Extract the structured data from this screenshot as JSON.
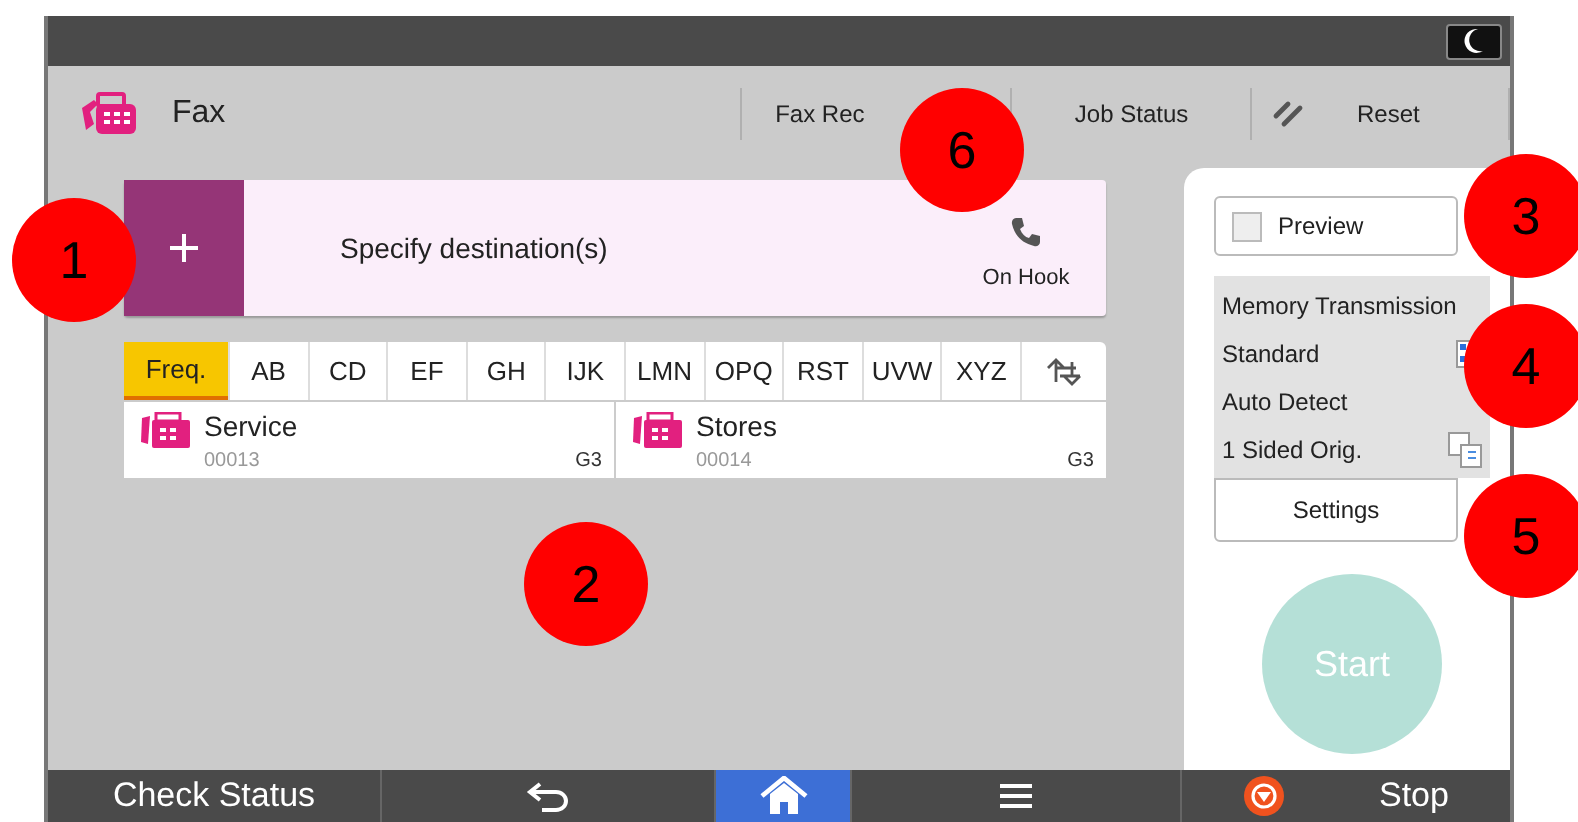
{
  "header": {
    "title": "Fax",
    "actions": [
      {
        "kind": "text",
        "label": "Fax Rec"
      },
      {
        "kind": "text",
        "label": "Job Status"
      },
      {
        "kind": "reset",
        "label": "Reset"
      }
    ]
  },
  "destination": {
    "label": "Specify destination(s)",
    "on_hook": "On Hook"
  },
  "index_tabs": [
    {
      "label": "Freq.",
      "selected": true
    },
    {
      "label": "AB",
      "selected": false
    },
    {
      "label": "CD",
      "selected": false
    },
    {
      "label": "EF",
      "selected": false
    },
    {
      "label": "GH",
      "selected": false
    },
    {
      "label": "IJK",
      "selected": false
    },
    {
      "label": "LMN",
      "selected": false
    },
    {
      "label": "OPQ",
      "selected": false
    },
    {
      "label": "RST",
      "selected": false
    },
    {
      "label": "UVW",
      "selected": false
    },
    {
      "label": "XYZ",
      "selected": false
    }
  ],
  "entries": [
    {
      "name": "Service",
      "number": "00013",
      "line": "G3"
    },
    {
      "name": "Stores",
      "number": "00014",
      "line": "G3"
    }
  ],
  "panel": {
    "preview": {
      "label": "Preview",
      "checked": false
    },
    "settings_summary": [
      {
        "label": "Memory Transmission",
        "kind": "text"
      },
      {
        "label": "Standard",
        "kind": "resolution"
      },
      {
        "label": "Auto Detect",
        "kind": "text"
      },
      {
        "label": "1 Sided Orig.",
        "kind": "sided"
      }
    ],
    "settings_button": "Settings",
    "start": {
      "label": "Start",
      "disabled": true
    }
  },
  "bottom_bar": [
    {
      "kind": "text",
      "label": "Check Status",
      "selected": false
    },
    {
      "kind": "back",
      "selected": false
    },
    {
      "kind": "home",
      "selected": true
    },
    {
      "kind": "menu",
      "selected": false
    },
    {
      "kind": "stop",
      "label": "Stop",
      "selected": false
    }
  ],
  "callouts": [
    "1",
    "2",
    "3",
    "4",
    "5",
    "6"
  ]
}
